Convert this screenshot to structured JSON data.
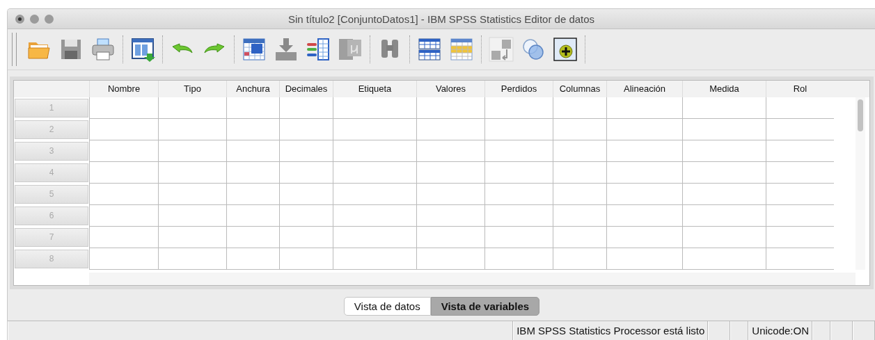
{
  "window": {
    "title": "Sin título2 [ConjuntoDatos1] - IBM SPSS Statistics Editor de datos"
  },
  "toolbar": {
    "groups": [
      [
        {
          "kind": "open",
          "disabled": false
        },
        {
          "kind": "save",
          "disabled": true
        },
        {
          "kind": "print",
          "disabled": false
        }
      ],
      [
        {
          "kind": "dialog",
          "disabled": false
        }
      ],
      [
        {
          "kind": "undo",
          "disabled": false
        },
        {
          "kind": "redo",
          "disabled": false
        }
      ],
      [
        {
          "kind": "goto",
          "disabled": false
        },
        {
          "kind": "insert-case",
          "disabled": true
        },
        {
          "kind": "insert-variable",
          "disabled": false
        },
        {
          "kind": "split",
          "disabled": true
        }
      ],
      [
        {
          "kind": "find",
          "disabled": true
        }
      ],
      [
        {
          "kind": "split-window",
          "disabled": false
        },
        {
          "kind": "select-table",
          "disabled": false
        }
      ],
      [
        {
          "kind": "labels",
          "disabled": true
        },
        {
          "kind": "sets",
          "disabled": false
        },
        {
          "kind": "addon",
          "disabled": false
        }
      ]
    ]
  },
  "table": {
    "columns": [
      "Nombre",
      "Tipo",
      "Anchura",
      "Decimales",
      "Etiqueta",
      "Valores",
      "Perdidos",
      "Columnas",
      "Alineación",
      "Medida",
      "Rol"
    ],
    "rows": [
      "1",
      "2",
      "3",
      "4",
      "5",
      "6",
      "7",
      "8"
    ]
  },
  "tabs": [
    {
      "label": "Vista de datos",
      "selected": false
    },
    {
      "label": "Vista de variables",
      "selected": true
    }
  ],
  "status_bar": {
    "processor": "IBM SPSS Statistics Processor está listo",
    "unicode": "Unicode:ON"
  }
}
